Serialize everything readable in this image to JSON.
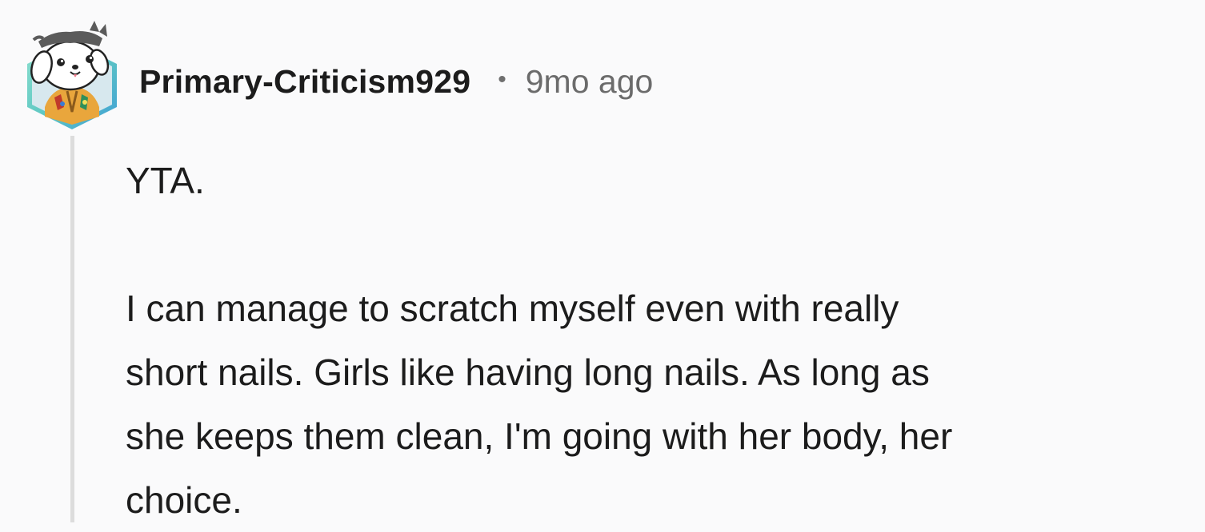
{
  "comment": {
    "author": "Primary-Criticism929",
    "separator": "•",
    "timestamp": "9mo ago",
    "avatar_icon": "cartoon-dog-avatar-icon",
    "body": {
      "paragraph_1": "YTA.",
      "paragraph_2_lines": [
        "I can manage to scratch myself even with really",
        "short nails. Girls like having long nails. As long as",
        "she keeps them clean, I'm going with her body, her",
        "choice."
      ]
    }
  },
  "colors": {
    "background": "#fafafb",
    "text": "#1c1c1c",
    "muted_text": "#6b6b6b",
    "thread_line": "#dcdcdc",
    "avatar_hex_teal": "#5fc8c3",
    "avatar_hex_blue": "#3f9fd6"
  }
}
